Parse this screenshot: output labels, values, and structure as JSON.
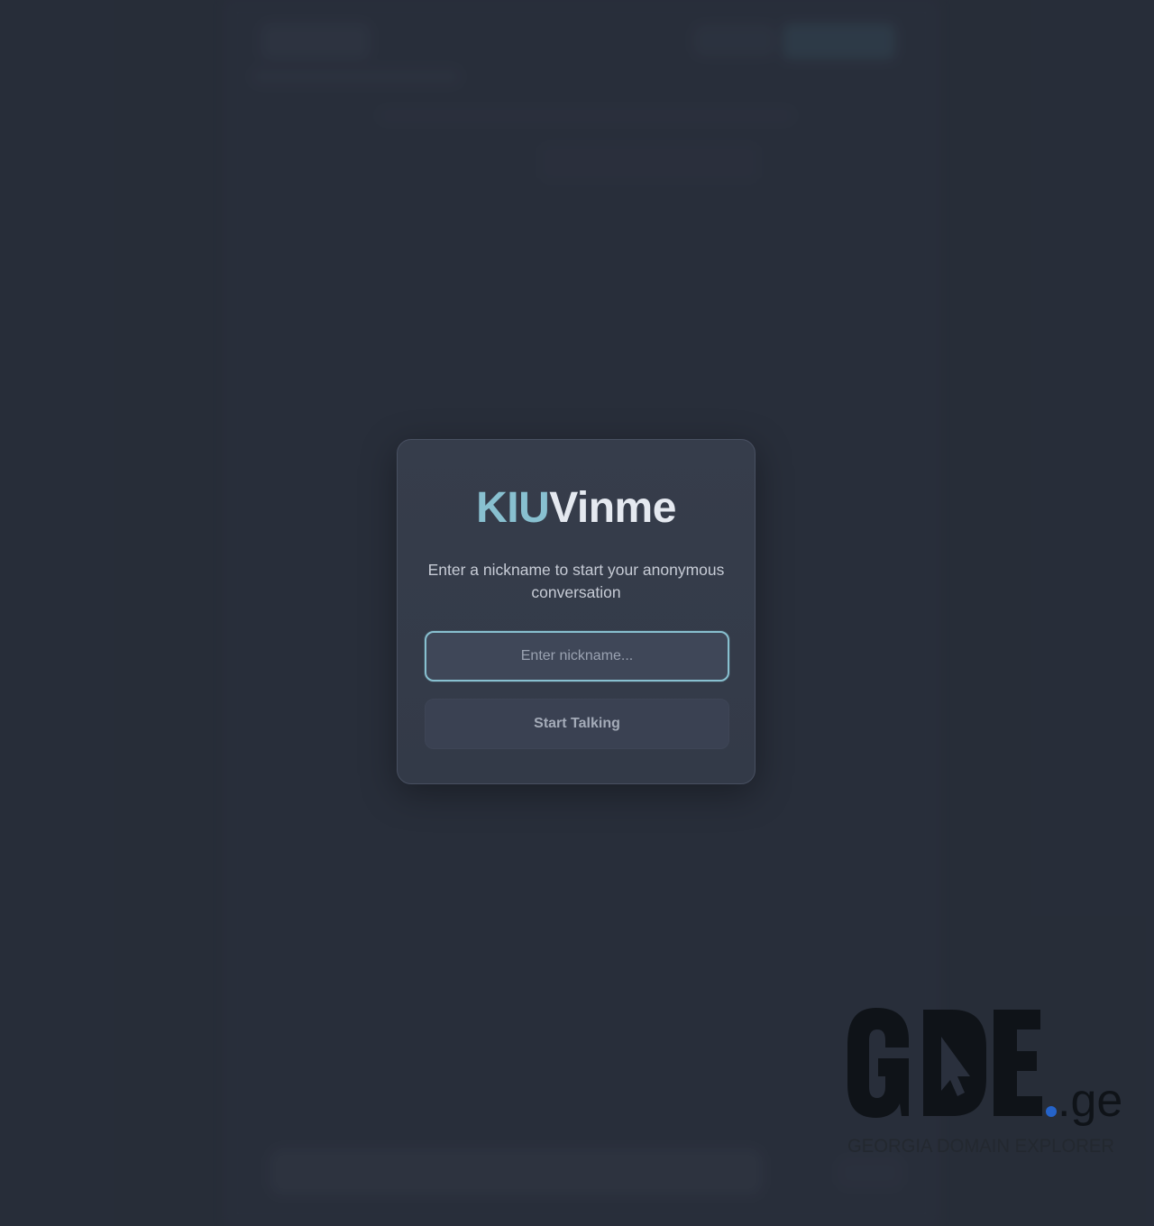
{
  "modal": {
    "brand_part1": "KIU",
    "brand_part2": "Vinme",
    "subtitle": "Enter a nickname to start your anonymous conversation",
    "nickname_placeholder": "Enter nickname...",
    "nickname_value": "",
    "start_button_label": "Start Talking"
  },
  "watermark": {
    "logo_text": "GDE",
    "logo_tld": ".ge",
    "logo_tagline": "GEORGIA DOMAIN EXPLORER"
  },
  "colors": {
    "accent": "#88c0d0",
    "background": "#2a303d",
    "modal_background": "#363d4b",
    "text_light": "#e5e9f0",
    "logo_dark": "#0f1318",
    "logo_dot": "#2563c9"
  }
}
